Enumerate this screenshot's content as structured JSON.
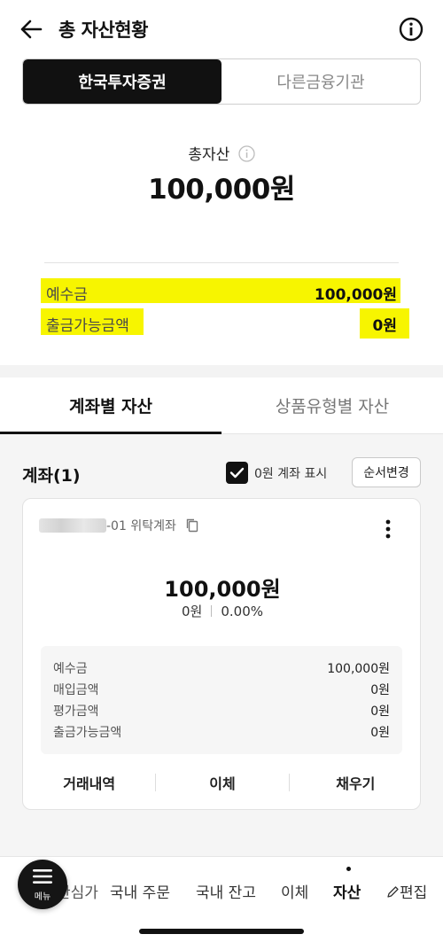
{
  "header": {
    "title": "총 자산현황",
    "back_icon": "arrow-left-icon",
    "info_icon": "info-circle-icon"
  },
  "segments": [
    {
      "label": "한국투자증권",
      "active": true
    },
    {
      "label": "다른금융기관",
      "active": false
    }
  ],
  "summary": {
    "label": "총자산",
    "amount": "100,000원"
  },
  "highlight_rows": [
    {
      "label": "예수금",
      "value": "100,000원"
    },
    {
      "label": "출금가능금액",
      "value": "0원"
    }
  ],
  "highlight_color": "#f7f500",
  "tabs": [
    {
      "label": "계좌별 자산",
      "active": true
    },
    {
      "label": "상품유형별 자산",
      "active": false
    }
  ],
  "accounts_section": {
    "title": "계좌(1)",
    "show_zero_label": "0원 계좌 표시",
    "show_zero_checked": true,
    "order_button": "순서변경"
  },
  "account_card": {
    "name": "-01 위탁계좌",
    "amount": "100,000원",
    "profit": "0원",
    "rate": "0.00%",
    "details": [
      {
        "label": "예수금",
        "value": "100,000원"
      },
      {
        "label": "매입금액",
        "value": "0원"
      },
      {
        "label": "평가금액",
        "value": "0원"
      },
      {
        "label": "출금가능금액",
        "value": "0원"
      }
    ],
    "actions": [
      "거래내역",
      "이체",
      "채우기"
    ]
  },
  "bottom_nav": {
    "menu_label": "메뉴",
    "items": [
      "관심가",
      "국내 주문",
      "국내 잔고",
      "이체",
      "자산",
      "편집"
    ],
    "active": "자산"
  }
}
